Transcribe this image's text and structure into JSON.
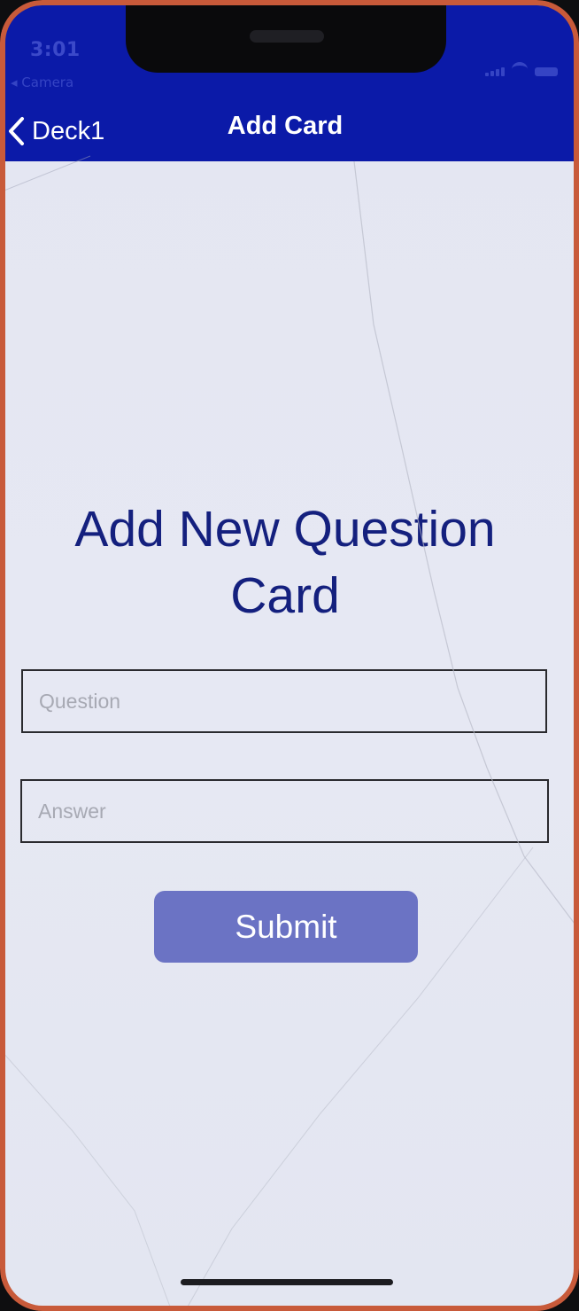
{
  "status_bar": {
    "time": "3:01",
    "back_to_app": "◂ Camera"
  },
  "nav": {
    "back_label": "Deck1",
    "title": "Add Card"
  },
  "form": {
    "heading": "Add New Question Card",
    "question_placeholder": "Question",
    "answer_placeholder": "Answer",
    "submit_label": "Submit"
  },
  "colors": {
    "header": "#0b1aa8",
    "heading_text": "#14207e",
    "button": "#6b73c4",
    "background": "#e4e6f2",
    "device_frame": "#c85a3a"
  },
  "icons": [
    "chevron-left-icon",
    "signal-icon",
    "wifi-icon",
    "battery-icon"
  ]
}
